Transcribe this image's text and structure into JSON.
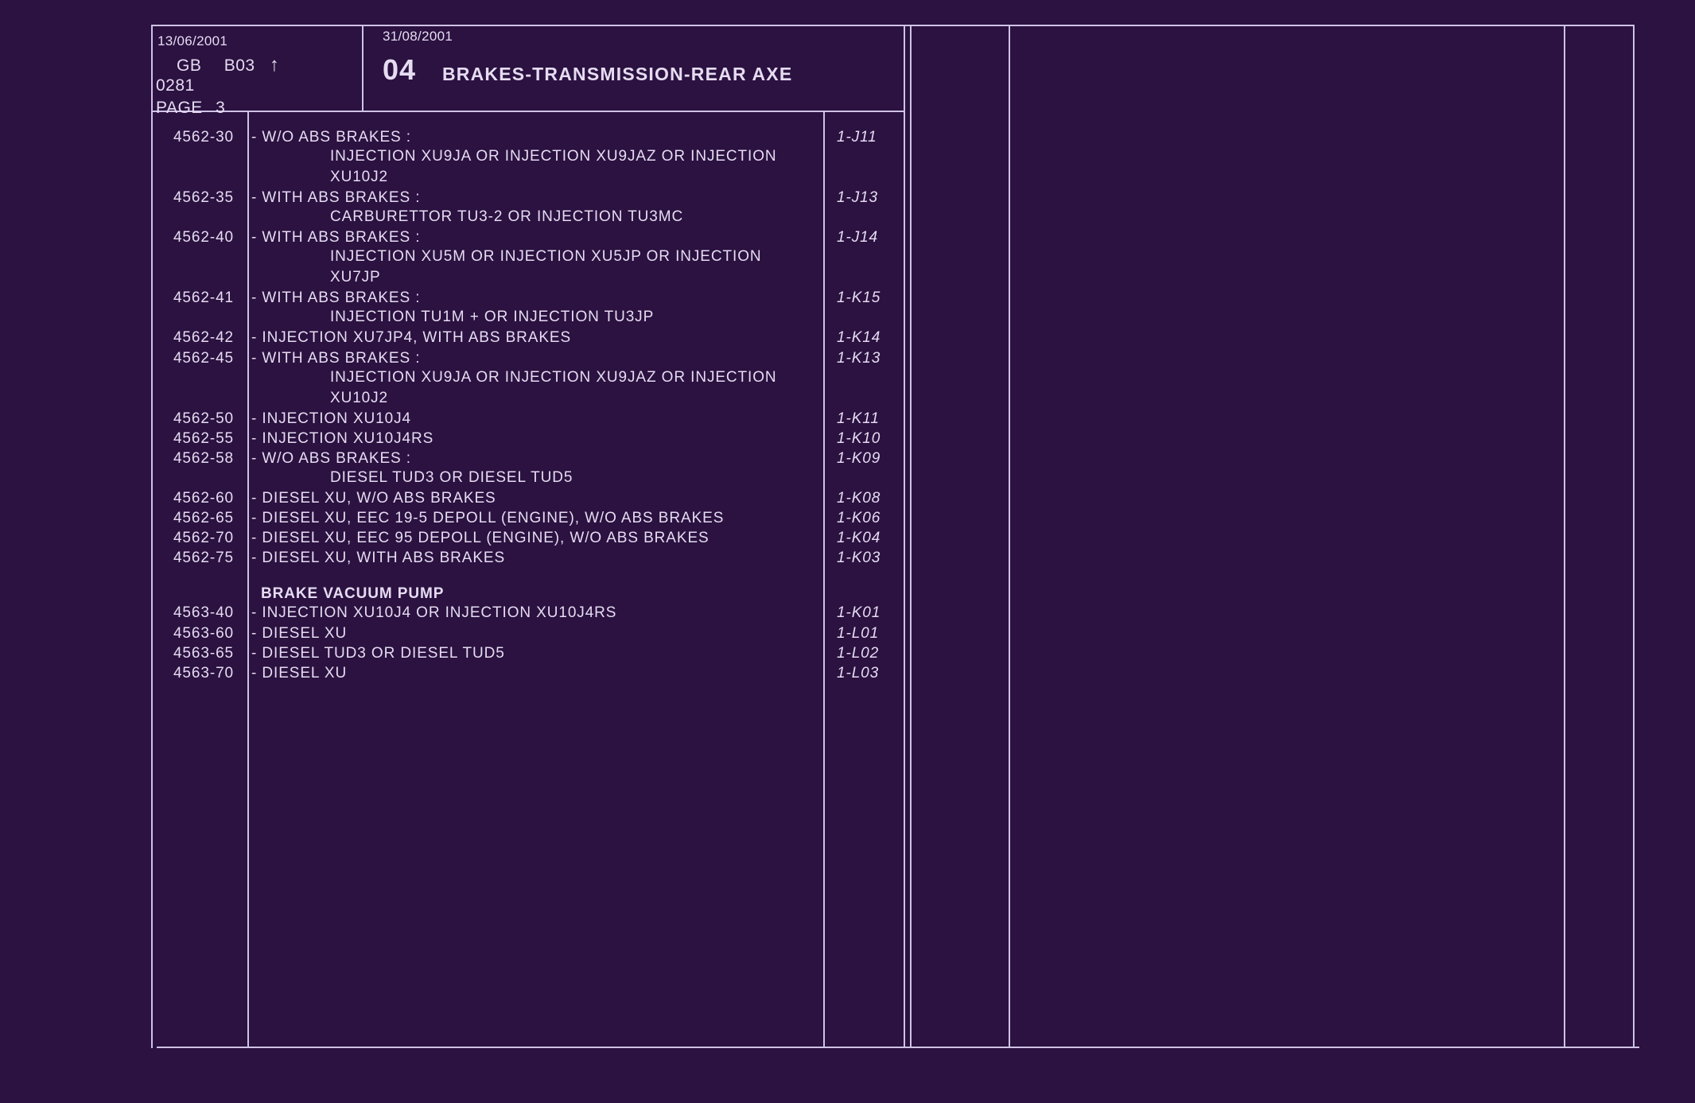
{
  "header": {
    "date_left": "13/06/2001",
    "country": "GB",
    "model": "B03",
    "arrow_icon": "up-arrow-icon",
    "code": "0281",
    "page_label": "PAGE",
    "page_number": "3",
    "date_right": "31/08/2001",
    "section_number": "04",
    "section_title": "BRAKES-TRANSMISSION-REAR AXE"
  },
  "rows": [
    {
      "code": "4562-30",
      "text": "- W/O ABS BRAKES :",
      "ref": "1-J11",
      "cont": [
        "INJECTION XU9JA OR INJECTION XU9JAZ OR INJECTION",
        "XU10J2"
      ]
    },
    {
      "code": "4562-35",
      "text": "- WITH ABS BRAKES :",
      "ref": "1-J13",
      "cont": [
        "CARBURETTOR TU3-2 OR INJECTION TU3MC"
      ]
    },
    {
      "code": "4562-40",
      "text": "- WITH ABS BRAKES :",
      "ref": "1-J14",
      "cont": [
        "INJECTION XU5M OR INJECTION XU5JP OR INJECTION",
        "XU7JP"
      ]
    },
    {
      "code": "4562-41",
      "text": "- WITH ABS BRAKES :",
      "ref": "1-K15",
      "cont": [
        "INJECTION TU1M + OR INJECTION TU3JP"
      ]
    },
    {
      "code": "4562-42",
      "text": "- INJECTION XU7JP4, WITH ABS BRAKES",
      "ref": "1-K14",
      "cont": []
    },
    {
      "code": "4562-45",
      "text": "- WITH ABS BRAKES :",
      "ref": "1-K13",
      "cont": [
        "INJECTION XU9JA OR INJECTION XU9JAZ OR INJECTION",
        "XU10J2"
      ]
    },
    {
      "code": "4562-50",
      "text": "- INJECTION XU10J4",
      "ref": "1-K11",
      "cont": []
    },
    {
      "code": "4562-55",
      "text": "- INJECTION XU10J4RS",
      "ref": "1-K10",
      "cont": []
    },
    {
      "code": "4562-58",
      "text": "- W/O ABS BRAKES :",
      "ref": "1-K09",
      "cont": [
        "DIESEL TUD3 OR DIESEL TUD5"
      ]
    },
    {
      "code": "4562-60",
      "text": "- DIESEL XU, W/O ABS BRAKES",
      "ref": "1-K08",
      "cont": []
    },
    {
      "code": "4562-65",
      "text": "- DIESEL XU, EEC 19-5 DEPOLL (ENGINE), W/O ABS BRAKES",
      "ref": "1-K06",
      "cont": []
    },
    {
      "code": "4562-70",
      "text": "- DIESEL XU, EEC 95 DEPOLL (ENGINE), W/O ABS BRAKES",
      "ref": "1-K04",
      "cont": []
    },
    {
      "code": "4562-75",
      "text": "- DIESEL XU, WITH ABS BRAKES",
      "ref": "1-K03",
      "cont": []
    }
  ],
  "group_heading": "BRAKE VACUUM PUMP",
  "rows2": [
    {
      "code": "4563-40",
      "text": "- INJECTION XU10J4 OR INJECTION XU10J4RS",
      "ref": "1-K01"
    },
    {
      "code": "4563-60",
      "text": "- DIESEL XU",
      "ref": "1-L01"
    },
    {
      "code": "4563-65",
      "text": "- DIESEL TUD3 OR DIESEL TUD5",
      "ref": "1-L02"
    },
    {
      "code": "4563-70",
      "text": "- DIESEL XU",
      "ref": "1-L03"
    }
  ]
}
